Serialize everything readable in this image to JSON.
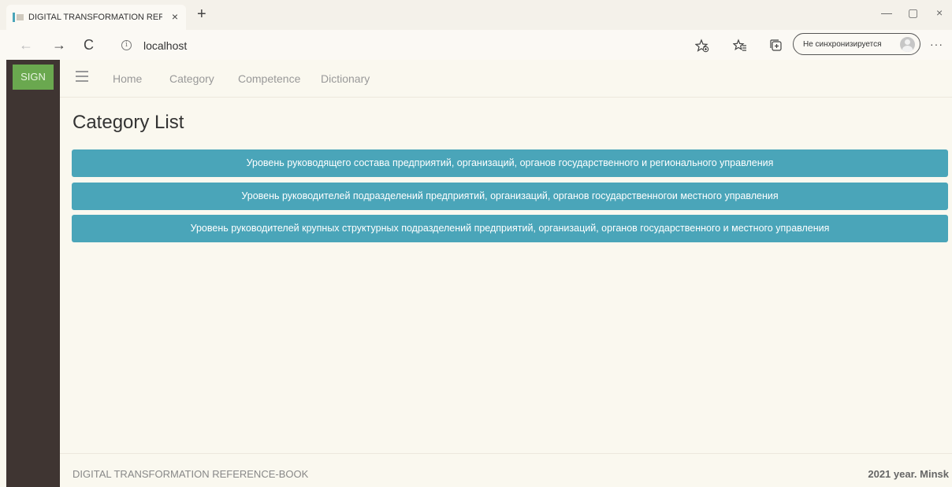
{
  "browser": {
    "tab_title": "DIGITAL TRANSFORMATION REF",
    "tab_close": "×",
    "new_tab": "+",
    "window_minimize": "—",
    "window_maximize": "▢",
    "window_close": "×",
    "back": "←",
    "forward": "→",
    "refresh": "C",
    "info": "i",
    "url": "localhost",
    "sync_label": "Не синхронизируется",
    "more": "···",
    "icons": [
      "favorites-add-icon",
      "favorites-icon",
      "collections-icon",
      "profile-avatar-icon"
    ]
  },
  "sidebar": {
    "sign_label": "SIGN"
  },
  "nav": {
    "menu_icon": "hamburger-icon",
    "items": [
      "Home",
      "Category",
      "Competence",
      "Dictionary"
    ]
  },
  "main": {
    "title": "Category List",
    "categories": [
      "Уровень руководящего состава предприятий, организаций, органов государственного и регионального управления",
      "Уровень руководителей подразделений предприятий, организаций, органов государственногои местного управления",
      "Уровень руководителей крупных структурных подразделений предприятий, организаций, органов государственного и местного управления"
    ]
  },
  "footer": {
    "left": "DIGITAL TRANSFORMATION REFERENCE-BOOK",
    "right": "2021 year. Minsk"
  },
  "colors": {
    "sidebar": "#3f3532",
    "sign_button": "#6aa84f",
    "category_button": "#4aa5b9",
    "page_background": "#faf8ef"
  }
}
